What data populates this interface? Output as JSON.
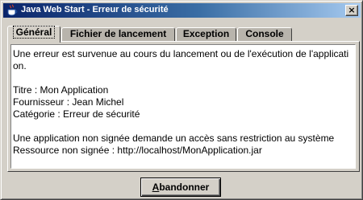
{
  "window": {
    "title": "Java Web Start - Erreur de sécurité",
    "app_icon": "java-cup-icon",
    "close_glyph": "×"
  },
  "tabs": [
    {
      "label": "Général",
      "active": true
    },
    {
      "label": "Fichier de lancement",
      "active": false
    },
    {
      "label": "Exception",
      "active": false
    },
    {
      "label": "Console",
      "active": false
    }
  ],
  "content": {
    "error_line_1": "Une erreur est survenue au cours du lancement ou de l'exécution de l'applicati",
    "error_line_2": "on.",
    "title_line": "Titre : Mon Application",
    "vendor_line": "Fournisseur : Jean Michel",
    "category_line": "Catégorie : Erreur de sécurité",
    "unsigned_app_line": "Une application non signée demande un accès sans restriction au système",
    "unsigned_resource_line": "Ressource non signée : http://localhost/MonApplication.jar"
  },
  "footer": {
    "abandon_mnemonic": "A",
    "abandon_rest": "bandonner"
  },
  "colors": {
    "titlebar_start": "#0a246a",
    "titlebar_end": "#a6caf0",
    "face": "#d4d0c8"
  }
}
